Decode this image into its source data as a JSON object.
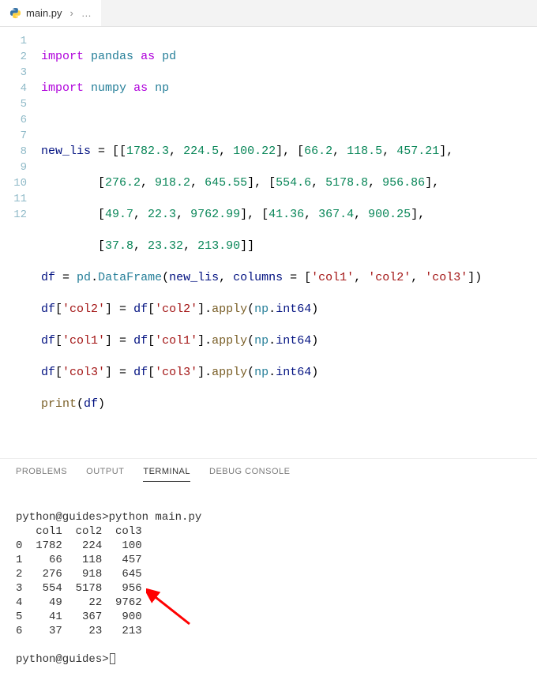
{
  "tab": {
    "filename": "main.py",
    "breadcrumb_more": "…"
  },
  "editor": {
    "line_numbers": [
      "1",
      "2",
      "3",
      "4",
      "5",
      "6",
      "7",
      "8",
      "9",
      "10",
      "11",
      "12"
    ],
    "active_line_index": 10,
    "tokens": {
      "import": "import",
      "as": "as",
      "pandas": "pandas",
      "numpy": "numpy",
      "pd": "pd",
      "np": "np",
      "new_lis": "new_lis",
      "df": "df",
      "DataFrame": "DataFrame",
      "columns": "columns",
      "apply": "apply",
      "int64": "int64",
      "print": "print",
      "col1": "'col1'",
      "col2": "'col2'",
      "col3": "'col3'"
    },
    "numbers": {
      "n1782_3": "1782.3",
      "n224_5": "224.5",
      "n100_22": "100.22",
      "n66_2": "66.2",
      "n118_5": "118.5",
      "n457_21": "457.21",
      "n276_2": "276.2",
      "n918_2": "918.2",
      "n645_55": "645.55",
      "n554_6": "554.6",
      "n5178_8": "5178.8",
      "n956_86": "956.86",
      "n49_7": "49.7",
      "n22_3": "22.3",
      "n9762_99": "9762.99",
      "n41_36": "41.36",
      "n367_4": "367.4",
      "n900_25": "900.25",
      "n37_8": "37.8",
      "n23_32": "23.32",
      "n213_90": "213.90"
    }
  },
  "panel_tabs": {
    "problems": "PROBLEMS",
    "output": "OUTPUT",
    "terminal": "TERMINAL",
    "debug_console": "DEBUG CONSOLE"
  },
  "terminal": {
    "prompt1": "python@guides>",
    "command": "python main.py",
    "header": "   col1  col2  col3",
    "rows": [
      "0  1782   224   100",
      "1    66   118   457",
      "2   276   918   645",
      "3   554  5178   956",
      "4    49    22  9762",
      "5    41   367   900",
      "6    37    23   213"
    ],
    "prompt2": "python@guides>"
  },
  "chart_data": {
    "type": "table",
    "title": "",
    "columns": [
      "col1",
      "col2",
      "col3"
    ],
    "index": [
      0,
      1,
      2,
      3,
      4,
      5,
      6
    ],
    "data": [
      [
        1782,
        224,
        100
      ],
      [
        66,
        118,
        457
      ],
      [
        276,
        918,
        645
      ],
      [
        554,
        5178,
        956
      ],
      [
        49,
        22,
        9762
      ],
      [
        41,
        367,
        900
      ],
      [
        37,
        23,
        213
      ]
    ]
  }
}
